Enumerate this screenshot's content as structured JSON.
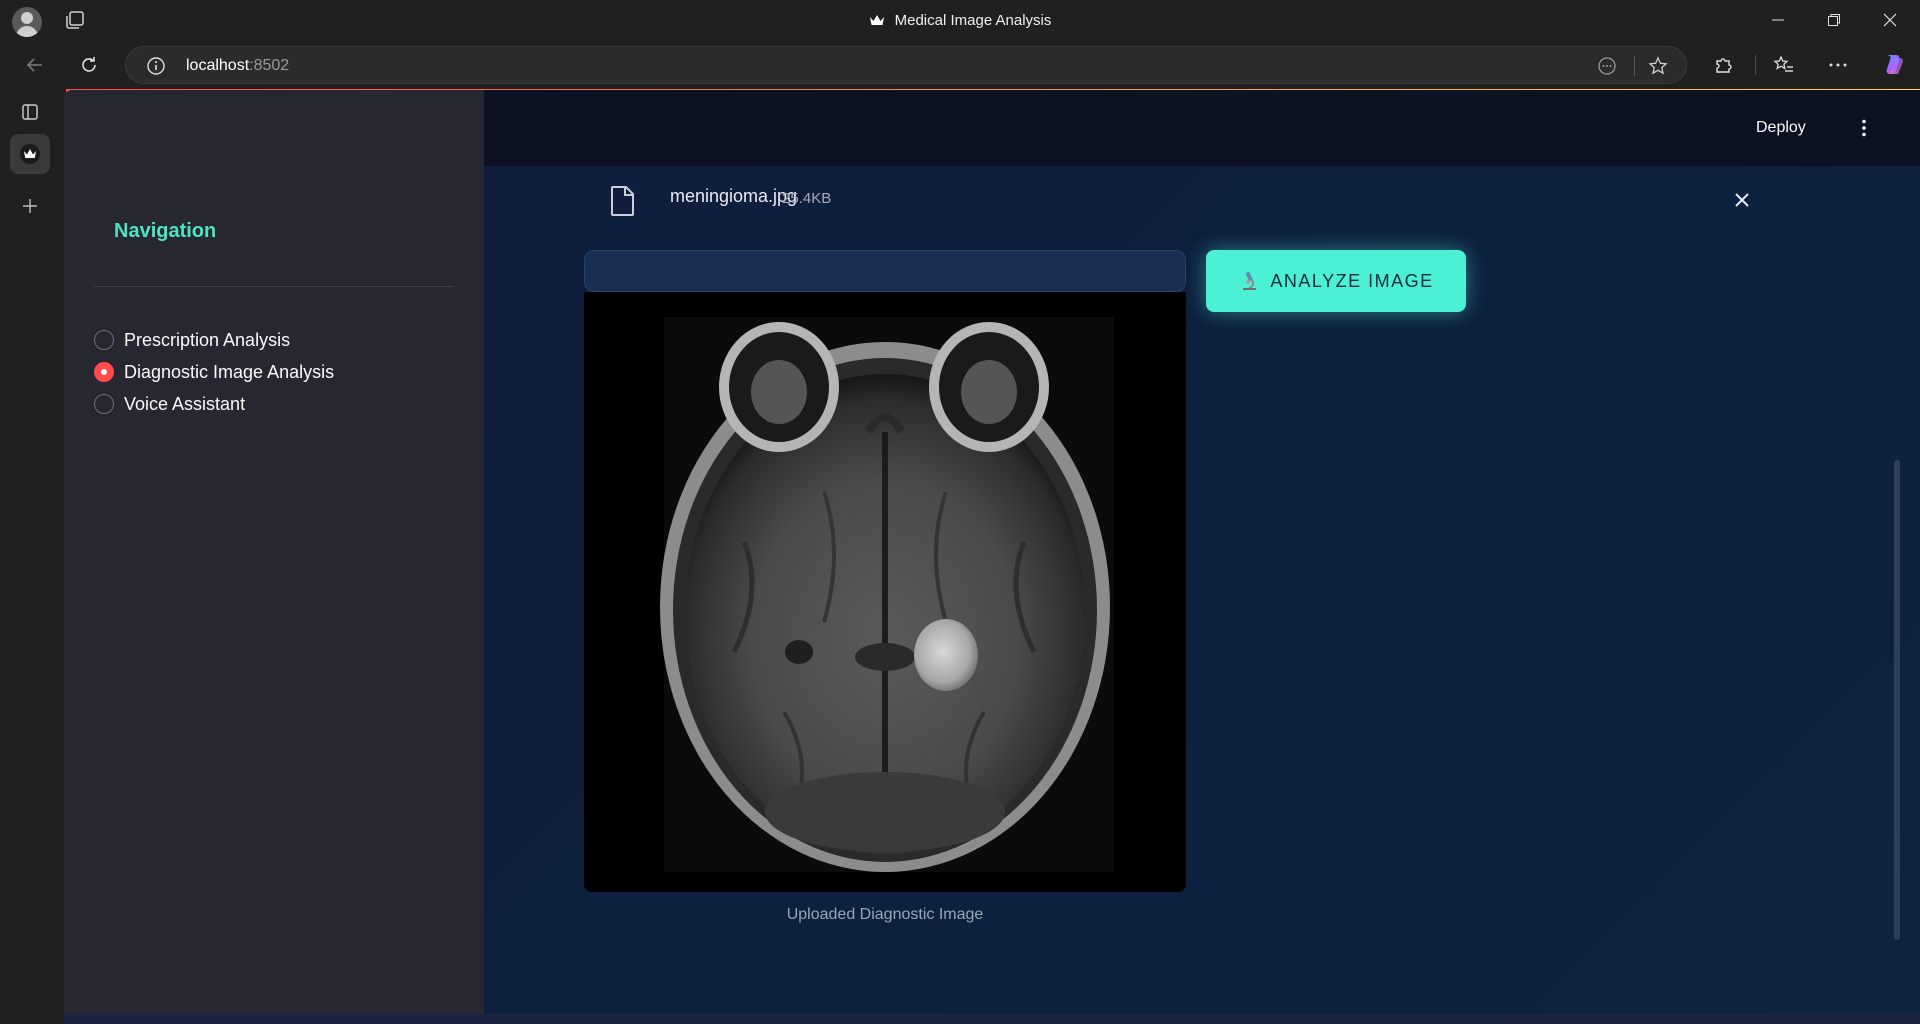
{
  "window": {
    "title": "Medical Image Analysis"
  },
  "browser": {
    "url_host": "localhost",
    "url_port": ":8502"
  },
  "sidebar": {
    "heading": "Navigation",
    "options": [
      {
        "label": "Prescription Analysis",
        "selected": false
      },
      {
        "label": "Diagnostic Image Analysis",
        "selected": true
      },
      {
        "label": "Voice Assistant",
        "selected": false
      }
    ]
  },
  "header": {
    "deploy_label": "Deploy"
  },
  "upload": {
    "file_name": "meningioma.jpg",
    "file_size": "25.4KB"
  },
  "image": {
    "caption": "Uploaded Diagnostic Image"
  },
  "actions": {
    "analyze_label": "ANALYZE IMAGE"
  },
  "colors": {
    "accent": "#4cf0d4",
    "radio_selected": "#ff4b4b",
    "sidebar_bg": "#262730",
    "main_bg": "#0e1e3c"
  },
  "icons": {
    "tab_actions": "tabs-icon",
    "back": "back-arrow-icon",
    "refresh": "refresh-icon",
    "info": "info-icon",
    "read_aloud": "more-circle-icon",
    "favorite": "star-icon",
    "extensions": "puzzle-icon",
    "favorites": "favorites-list-icon",
    "more": "ellipsis-icon",
    "copilot": "copilot-icon",
    "file": "file-icon",
    "close": "close-icon",
    "kebab": "kebab-menu-icon",
    "analyze": "microscope-icon"
  }
}
